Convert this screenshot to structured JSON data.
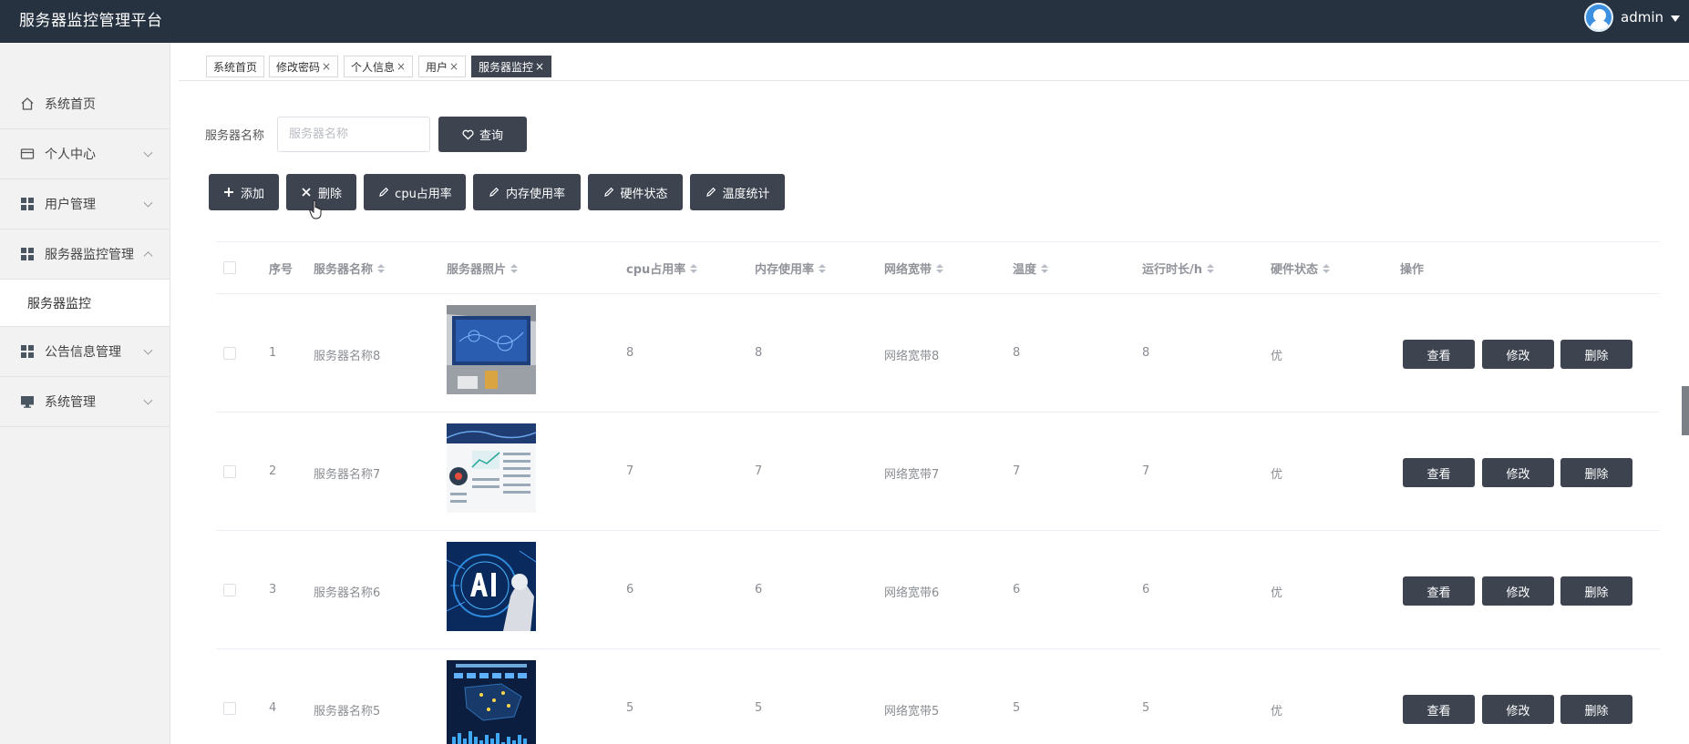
{
  "app": {
    "title": "服务器监控管理平台"
  },
  "user": {
    "name": "admin"
  },
  "sidebar": {
    "items": [
      {
        "label": "系统首页"
      },
      {
        "label": "个人中心"
      },
      {
        "label": "用户管理"
      },
      {
        "label": "服务器监控管理"
      },
      {
        "label": "公告信息管理"
      },
      {
        "label": "系统管理"
      }
    ],
    "sub_items": [
      {
        "label": "服务器监控"
      }
    ]
  },
  "tabs": [
    {
      "label": "系统首页"
    },
    {
      "label": "修改密码"
    },
    {
      "label": "个人信息"
    },
    {
      "label": "用户"
    },
    {
      "label": "服务器监控"
    }
  ],
  "tab_close_glyph": "×",
  "search": {
    "label": "服务器名称",
    "placeholder": "服务器名称",
    "value": "",
    "button": "查询"
  },
  "toolbar": {
    "add": "添加",
    "delete": "删除",
    "cpu": "cpu占用率",
    "memory": "内存使用率",
    "hardware": "硬件状态",
    "temperature": "温度统计"
  },
  "table": {
    "headers": {
      "index": "序号",
      "name": "服务器名称",
      "photo": "服务器照片",
      "cpu": "cpu占用率",
      "memory": "内存使用率",
      "bandwidth": "网络宽带",
      "temperature": "温度",
      "uptime": "运行时长/h",
      "hardware": "硬件状态",
      "actions": "操作"
    },
    "rows": [
      {
        "index": "1",
        "name": "服务器名称8",
        "cpu": "8",
        "memory": "8",
        "bandwidth": "网络宽带8",
        "temperature": "8",
        "uptime": "8",
        "hardware": "优"
      },
      {
        "index": "2",
        "name": "服务器名称7",
        "cpu": "7",
        "memory": "7",
        "bandwidth": "网络宽带7",
        "temperature": "7",
        "uptime": "7",
        "hardware": "优"
      },
      {
        "index": "3",
        "name": "服务器名称6",
        "cpu": "6",
        "memory": "6",
        "bandwidth": "网络宽带6",
        "temperature": "6",
        "uptime": "6",
        "hardware": "优"
      },
      {
        "index": "4",
        "name": "服务器名称5",
        "cpu": "5",
        "memory": "5",
        "bandwidth": "网络宽带5",
        "temperature": "5",
        "uptime": "5",
        "hardware": "优"
      }
    ],
    "row_actions": {
      "view": "查看",
      "edit": "修改",
      "delete": "删除"
    }
  },
  "colors": {
    "topbar": "#263240",
    "button": "#3d4450",
    "sidebar": "#f2f2f2"
  }
}
